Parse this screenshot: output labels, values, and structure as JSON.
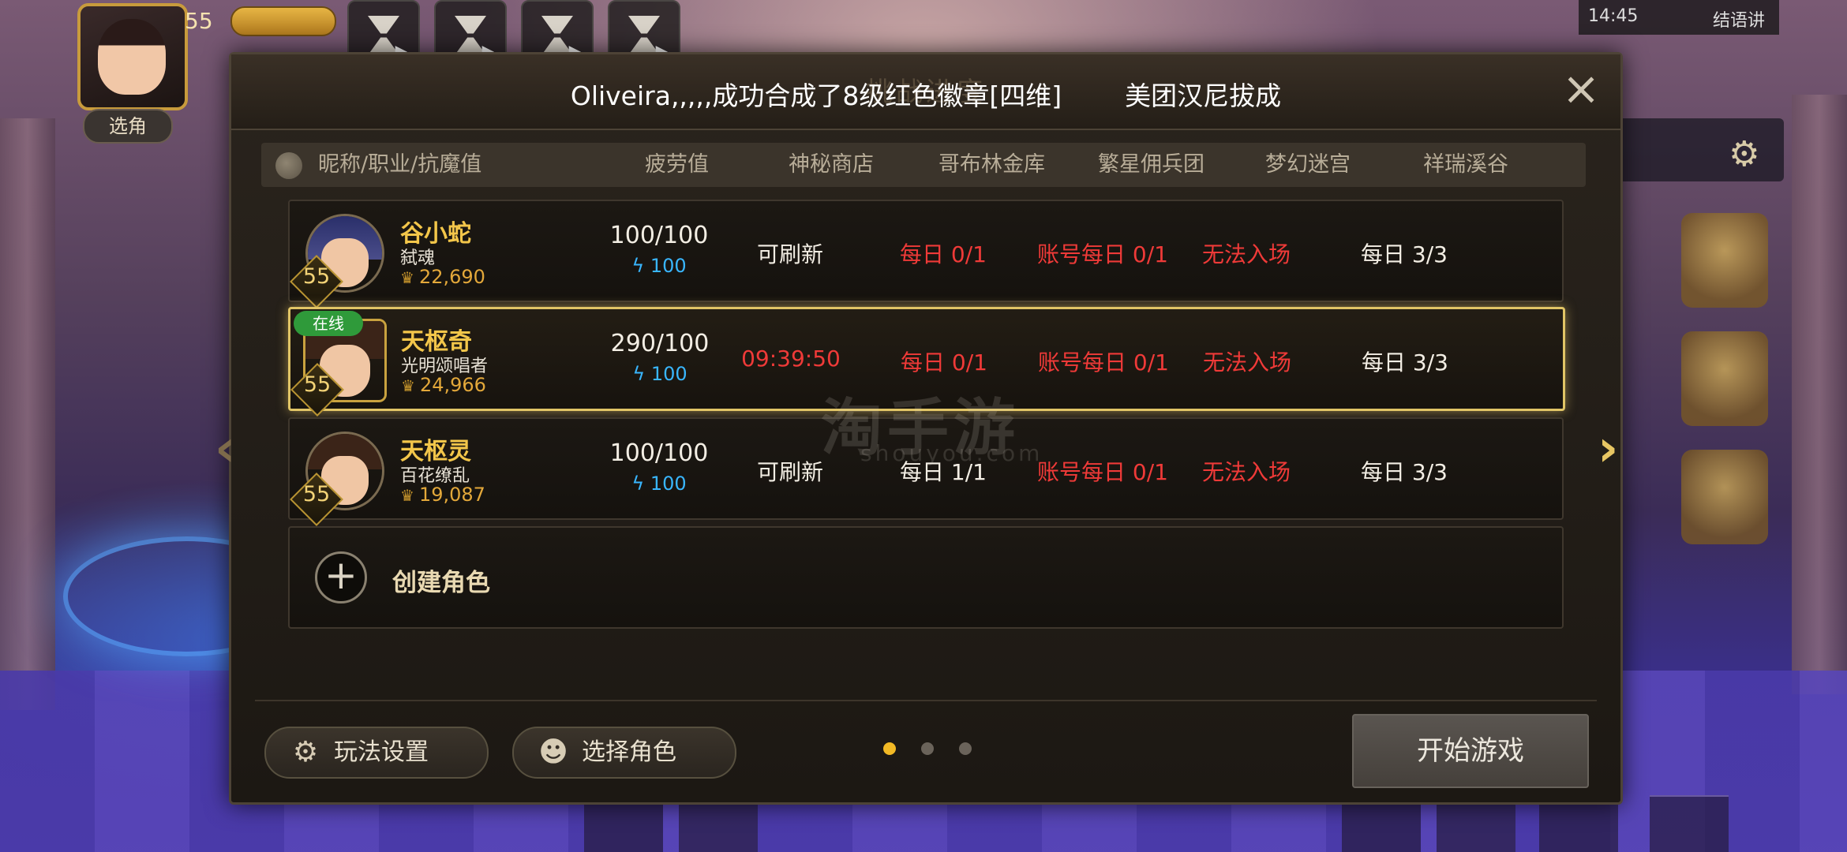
{
  "hud": {
    "level": "55",
    "small_button": "选角",
    "status_time": "14:45",
    "status_net": "结语讲"
  },
  "replay_buttons": [
    "hourglass-1",
    "hourglass-2",
    "hourglass-3",
    "hourglass-4"
  ],
  "dialog": {
    "ghost_title": "挑战进度",
    "notice_left": "Oliveira,,,,,成功合成了8级红色徽章[四维]",
    "notice_right": "美团汉尼拔成",
    "close_label": "×"
  },
  "table": {
    "headers": [
      "昵称/职业/抗魔值",
      "疲劳值",
      "神秘商店",
      "哥布林金库",
      "繁星佣兵团",
      "梦幻迷宫",
      "祥瑞溪谷"
    ],
    "rows": [
      {
        "name": "谷小蛇",
        "job": "弑魂",
        "power": "22,690",
        "level": "55",
        "fatigue": "100/100",
        "energy": "100",
        "shop": "可刷新",
        "goblin": "每日 0/1",
        "mercenary": "账号每日 0/1",
        "maze": "无法入场",
        "valley": "每日 3/3"
      },
      {
        "name": "天枢奇",
        "job": "光明颂唱者",
        "power": "24,966",
        "level": "55",
        "online": "在线",
        "fatigue": "290/100",
        "energy": "100",
        "shop": "09:39:50",
        "goblin": "每日 0/1",
        "mercenary": "账号每日 0/1",
        "maze": "无法入场",
        "valley": "每日 3/3"
      },
      {
        "name": "天枢灵",
        "job": "百花缭乱",
        "power": "19,087",
        "level": "55",
        "fatigue": "100/100",
        "energy": "100",
        "shop": "可刷新",
        "goblin": "每日 1/1",
        "mercenary": "账号每日 0/1",
        "maze": "无法入场",
        "valley": "每日 3/3"
      }
    ],
    "create_label": "创建角色"
  },
  "footer": {
    "settings_label": "玩法设置",
    "select_label": "选择角色",
    "start_label": "开始游戏",
    "page_dots": 3,
    "active_page": 1
  },
  "watermark": {
    "text": "淘手游",
    "subtext": "shouyou.com"
  },
  "colors": {
    "accent_gold": "#f3c64a",
    "warn_red": "#ef3a38",
    "energy_blue": "#39b6ff",
    "online_green": "#2f9a3a"
  }
}
